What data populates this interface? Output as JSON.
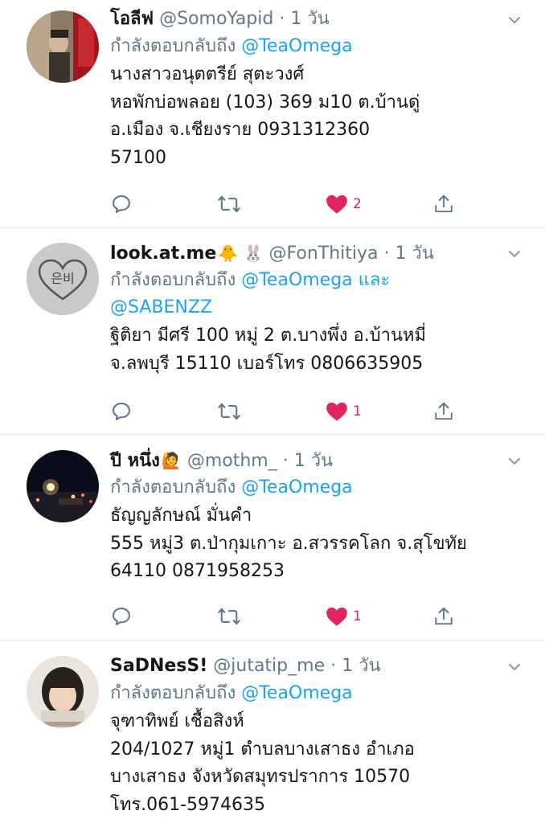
{
  "tweets": [
    {
      "name": "โอลีฟ",
      "handle": "@SomoYapid",
      "time": "1 วัน",
      "reply_prefix": "กำลังตอบกลับถึง",
      "reply_mentions": "@TeaOmega",
      "reply_line2": "",
      "body": [
        "นางสาวอนุตตรีย์  สุตะวงศ์",
        "หอพักบ่อพลอย (103) 369 ม10 ต.บ้านดู่",
        "อ.เมือง จ.เชียงราย 0931312360",
        "57100"
      ],
      "likes": "2"
    },
    {
      "name": "look.at.me",
      "emoji": "🐥 🐰",
      "handle": "@FonThitiya",
      "time": "1 วัน",
      "reply_prefix": "กำลังตอบกลับถึง",
      "reply_mentions": "@TeaOmega",
      "reply_and": "และ",
      "reply_line2": "@SABENZZ",
      "body": [
        "ฐิติยา มีศรี  100 หมู่ 2 ต.บางพึ่ง อ.บ้านหมี่",
        "จ.ลพบุรี 15110 เบอร์โทร 0806635905"
      ],
      "likes": "1"
    },
    {
      "name": "ปี หนึ่ง",
      "emoji": "🙋",
      "handle": "@mothm_",
      "time": "1 วัน",
      "reply_prefix": "กำลังตอบกลับถึง",
      "reply_mentions": "@TeaOmega",
      "reply_line2": "",
      "body": [
        "ธัญญลักษณ์ มั่นคำ",
        "555 หมู่3 ต.ป่ากุมเกาะ อ.สวรรคโลก จ.สุโขทัย",
        "64110 0871958253"
      ],
      "likes": "1"
    },
    {
      "name": "SaDNesS!",
      "handle": "@jutatip_me",
      "time": "1 วัน",
      "reply_prefix": "กำลังตอบกลับถึง",
      "reply_mentions": "@TeaOmega",
      "reply_line2": "",
      "body": [
        "จุฑาทิพย์ เชื้อสิงห์",
        "204/1027 หมู่1 ตำบลบางเสาธง อำเภอ",
        "บางเสาธง จังหวัดสมุทรปราการ 10570",
        "โทร.061-5974635"
      ],
      "likes": ""
    }
  ],
  "icons": {
    "reply": "reply-icon",
    "retweet": "retweet-icon",
    "like": "heart-icon",
    "share": "share-icon",
    "more": "chevron-down-icon"
  },
  "colors": {
    "accent": "#1da1f2",
    "like": "#e0245e",
    "muted": "#657786"
  }
}
